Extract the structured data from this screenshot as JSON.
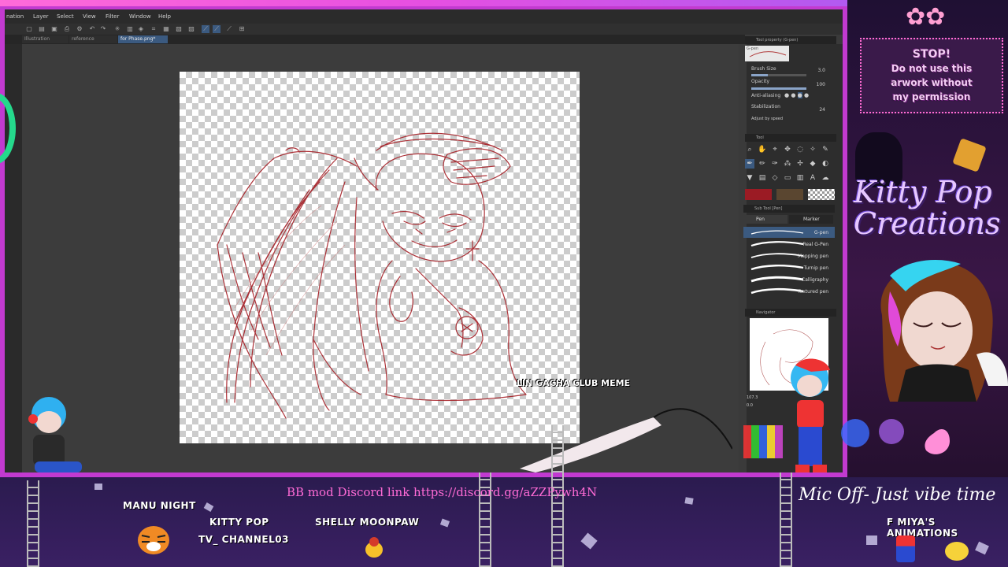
{
  "app": {
    "menu": [
      "nation",
      "Layer",
      "Select",
      "View",
      "Filter",
      "Window",
      "Help"
    ],
    "tabs": [
      "Illustration",
      "reference",
      "for Phase.png*"
    ],
    "active_tab_index": 2
  },
  "tool_property": {
    "title": "Tool property (G-pen)",
    "preset": "G-pen",
    "brush_size_label": "Brush Size",
    "brush_size_value": "3.0",
    "brush_size_level": 0.3,
    "opacity_label": "Opacity",
    "opacity_value": "100",
    "opacity_level": 1.0,
    "antialias_label": "Anti-aliasing",
    "stabilization_label": "Stabilization",
    "stabilization_value": "24",
    "adjust_label": "Adjust by speed"
  },
  "tool_panel": {
    "title": "Tool"
  },
  "colors": {
    "main": "#9b1b24",
    "sub": "#5a4630",
    "frame": "#c23ad0",
    "discord": "#ff6bd6"
  },
  "sub_tool": {
    "title": "Sub Tool [Pen]",
    "tab_pen": "Pen",
    "tab_marker": "Marker",
    "items": [
      "G-pen",
      "Real G-Pen",
      "Mapping pen",
      "Turnip pen",
      "Calligraphy",
      "Textured pen"
    ],
    "selected_index": 0
  },
  "navigator": {
    "title": "Navigator",
    "zoom": "107.3",
    "rotation": "0.0"
  },
  "overlay": {
    "stop_lines": [
      "STOP!",
      "Do not use this",
      "arwork without",
      "my permission"
    ],
    "brand": "Kitty Pop Creations",
    "discord": "BB mod Discord link https://discord.gg/aZZPywh4N",
    "status": "Mic Off- Just vibe time",
    "meme": "LIN GACHA CLUB MEME",
    "names": [
      "MANU NIGHT",
      "KITTY POP",
      "TV_ CHANNEL03",
      "SHELLY MOONPAW",
      "F MIYA'S ANIMATIONS"
    ]
  }
}
